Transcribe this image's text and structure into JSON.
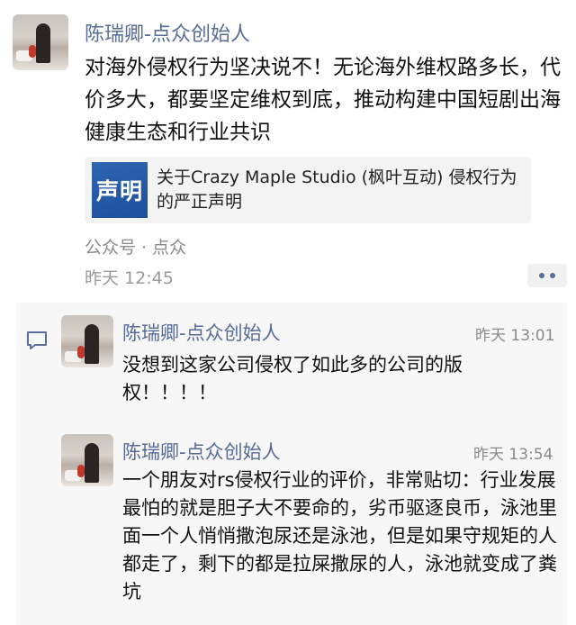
{
  "post": {
    "author": "陈瑞卿-点众创始人",
    "text": "对海外侵权行为坚决说不！无论海外维权路多长，代价多大，都要坚定维权到底，推动构建中国短剧出海健康生态和行业共识",
    "link": {
      "thumb_text": "声明",
      "title": "关于Crazy Maple Studio (枫叶互动) 侵权行为的严正声明"
    },
    "source": "公众号 · 点众",
    "time": "昨天 12:45",
    "more_icon": "more-dots-icon"
  },
  "comments": [
    {
      "author": "陈瑞卿-点众创始人",
      "time": "昨天 13:01",
      "text": "没想到这家公司侵权了如此多的公司的版权！！！！"
    },
    {
      "author": "陈瑞卿-点众创始人",
      "time": "昨天 13:54",
      "text": "一个朋友对rs侵权行业的评价，非常贴切：行业发展最怕的就是胆子大不要命的，劣币驱逐良币，泳池里面一个人悄悄撒泡尿还是泳池，但是如果守规矩的人都走了，剩下的都是拉屎撒尿的人，泳池就变成了粪坑"
    }
  ],
  "colors": {
    "name": "#576b95",
    "comment_bg": "#f7f7f7",
    "link_bg": "#f3f3f3",
    "thumb": "#2f66b0"
  }
}
